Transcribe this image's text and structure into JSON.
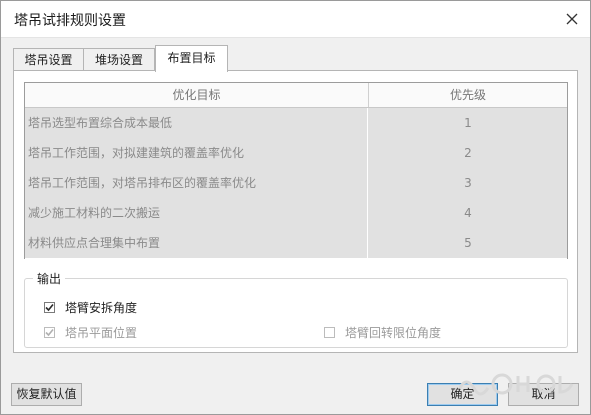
{
  "window": {
    "title": "塔吊试排规则设置"
  },
  "tabs": [
    {
      "label": "塔吊设置",
      "active": false
    },
    {
      "label": "堆场设置",
      "active": false
    },
    {
      "label": "布置目标",
      "active": true
    }
  ],
  "table": {
    "headers": {
      "goal": "优化目标",
      "priority": "优先级"
    },
    "rows": [
      {
        "goal": "塔吊选型布置综合成本最低",
        "priority": "1"
      },
      {
        "goal": "塔吊工作范围，对拟建建筑的覆盖率优化",
        "priority": "2"
      },
      {
        "goal": "塔吊工作范围，对塔吊排布区的覆盖率优化",
        "priority": "3"
      },
      {
        "goal": "减少施工材料的二次搬运",
        "priority": "4"
      },
      {
        "goal": "材料供应点合理集中布置",
        "priority": "5"
      }
    ]
  },
  "output": {
    "legend": "输出",
    "options": {
      "boom_angle": {
        "label": "塔臂安拆角度",
        "checked": true,
        "enabled": true
      },
      "plane_position": {
        "label": "塔吊平面位置",
        "checked": true,
        "enabled": false
      },
      "slew_limit": {
        "label": "塔臂回转限位角度",
        "checked": false,
        "enabled": true
      }
    }
  },
  "buttons": {
    "restore": "恢复默认值",
    "ok": "确定",
    "cancel": "取消"
  },
  "colors": {
    "annotation_red": "#e8202a",
    "check_mark": "#2b2b2b",
    "check_mark_disabled": "#b0b0b0"
  }
}
